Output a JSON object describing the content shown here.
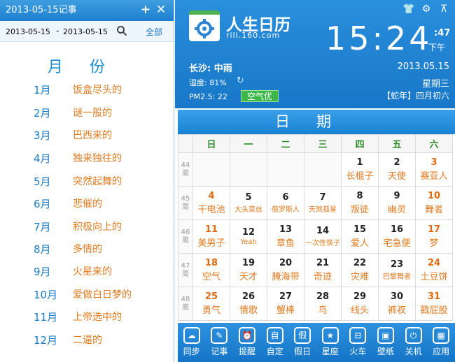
{
  "left_panel": {
    "title": "2013-05-15记事",
    "plus_icon": "plus-icon",
    "close_icon": "close-icon",
    "date_from": "2013-05-15",
    "date_sep": "-",
    "date_to": "2013-05-15",
    "all_label": "全部",
    "month_heading": "月份",
    "months": [
      {
        "num": "1月",
        "desc": "饭盒尽头的"
      },
      {
        "num": "2月",
        "desc": "谜一般的"
      },
      {
        "num": "3月",
        "desc": "巴西来的"
      },
      {
        "num": "4月",
        "desc": "独来独往的"
      },
      {
        "num": "5月",
        "desc": "突然起舞的"
      },
      {
        "num": "6月",
        "desc": "悲催的"
      },
      {
        "num": "7月",
        "desc": "积极向上的"
      },
      {
        "num": "8月",
        "desc": "多情的"
      },
      {
        "num": "9月",
        "desc": "火星来的"
      },
      {
        "num": "10月",
        "desc": "爱做白日梦的"
      },
      {
        "num": "11月",
        "desc": "上帝选中的"
      },
      {
        "num": "12月",
        "desc": "二逼的"
      }
    ]
  },
  "header": {
    "logo_text": "人生日历",
    "logo_url": "rili.160.com",
    "time": "15:24",
    "seconds": ":47",
    "ampm": "下午",
    "city_weather": "长沙: 中雨",
    "humidity": "湿度: 81%",
    "pm_label": "PM2.5: 22",
    "aqi": "空气优",
    "date": "2013.05.15",
    "weekday": "星期三",
    "lunar": "【蛇年】四月初六"
  },
  "calendar": {
    "title": "日期",
    "weekdays": [
      "日",
      "一",
      "二",
      "三",
      "四",
      "五",
      "六"
    ],
    "weeks": [
      {
        "wk": "44周",
        "days": [
          {
            "n": "",
            "l": ""
          },
          {
            "n": "",
            "l": ""
          },
          {
            "n": "",
            "l": ""
          },
          {
            "n": "",
            "l": ""
          },
          {
            "n": "1",
            "l": "长棍子"
          },
          {
            "n": "2",
            "l": "天使"
          },
          {
            "n": "3",
            "l": "赛亚人"
          }
        ]
      },
      {
        "wk": "45周",
        "days": [
          {
            "n": "4",
            "l": "干电池"
          },
          {
            "n": "5",
            "l": "大头菜丝"
          },
          {
            "n": "6",
            "l": "俄罗斯人"
          },
          {
            "n": "7",
            "l": "天煞孤星"
          },
          {
            "n": "8",
            "l": "叛徒"
          },
          {
            "n": "9",
            "l": "幽灵"
          },
          {
            "n": "10",
            "l": "舞者"
          }
        ]
      },
      {
        "wk": "46周",
        "days": [
          {
            "n": "11",
            "l": "美男子"
          },
          {
            "n": "12",
            "l": "Yeah"
          },
          {
            "n": "13",
            "l": "章鱼"
          },
          {
            "n": "14",
            "l": "一次性筷子"
          },
          {
            "n": "15",
            "l": "爱人"
          },
          {
            "n": "16",
            "l": "宅急便"
          },
          {
            "n": "17",
            "l": "梦"
          }
        ]
      },
      {
        "wk": "47周",
        "days": [
          {
            "n": "18",
            "l": "空气"
          },
          {
            "n": "19",
            "l": "天才"
          },
          {
            "n": "20",
            "l": "腌海带"
          },
          {
            "n": "21",
            "l": "奇迹"
          },
          {
            "n": "22",
            "l": "灾难"
          },
          {
            "n": "23",
            "l": "巴黎舞者"
          },
          {
            "n": "24",
            "l": "土豆饼"
          }
        ]
      },
      {
        "wk": "48周",
        "days": [
          {
            "n": "25",
            "l": "勇气"
          },
          {
            "n": "26",
            "l": "情歌"
          },
          {
            "n": "27",
            "l": "蟹棒"
          },
          {
            "n": "28",
            "l": "鸟"
          },
          {
            "n": "29",
            "l": "线头"
          },
          {
            "n": "30",
            "l": "裤衩"
          },
          {
            "n": "31",
            "l": "戳屁股"
          }
        ]
      }
    ]
  },
  "toolbar": [
    {
      "label": "同步",
      "icon": "cloud-icon"
    },
    {
      "label": "记事",
      "icon": "note-icon"
    },
    {
      "label": "提醒",
      "icon": "alarm-icon"
    },
    {
      "label": "自定",
      "icon": "custom-icon"
    },
    {
      "label": "假日",
      "icon": "holiday-icon"
    },
    {
      "label": "星座",
      "icon": "star-icon"
    },
    {
      "label": "火车",
      "icon": "train-icon"
    },
    {
      "label": "壁纸",
      "icon": "wallpaper-icon"
    },
    {
      "label": "关机",
      "icon": "power-icon"
    },
    {
      "label": "应用",
      "icon": "apps-icon"
    }
  ]
}
